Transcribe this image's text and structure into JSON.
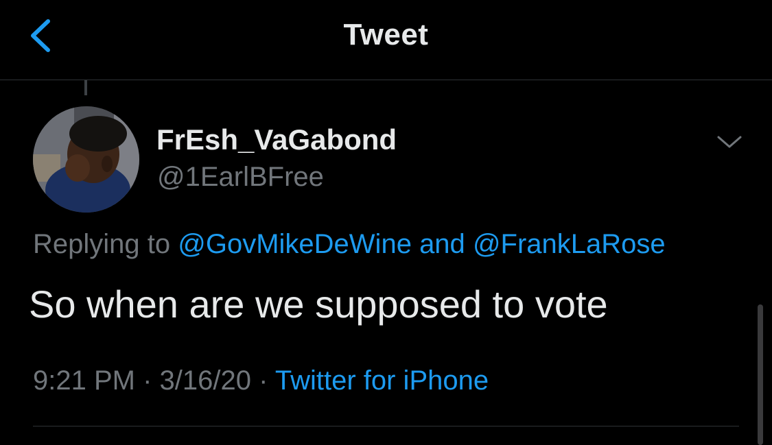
{
  "header": {
    "title": "Tweet",
    "back_icon": "chevron-left-icon"
  },
  "tweet": {
    "display_name": "FrEsh_VaGabond",
    "handle": "@1EarlBFree",
    "replying_prefix": "Replying to",
    "reply_to": [
      "@GovMikeDeWine",
      "@FrankLaRose"
    ],
    "reply_joiner": "and",
    "text": "So when are we supposed to vote",
    "time": "9:21 PM",
    "separator": "·",
    "date": "3/16/20",
    "source": "Twitter for iPhone",
    "menu_icon": "chevron-down-icon"
  },
  "colors": {
    "background": "#000000",
    "primary_text": "#e7e9ea",
    "secondary_text": "#71767b",
    "accent": "#1d9bf0",
    "divider": "#2f3336"
  }
}
